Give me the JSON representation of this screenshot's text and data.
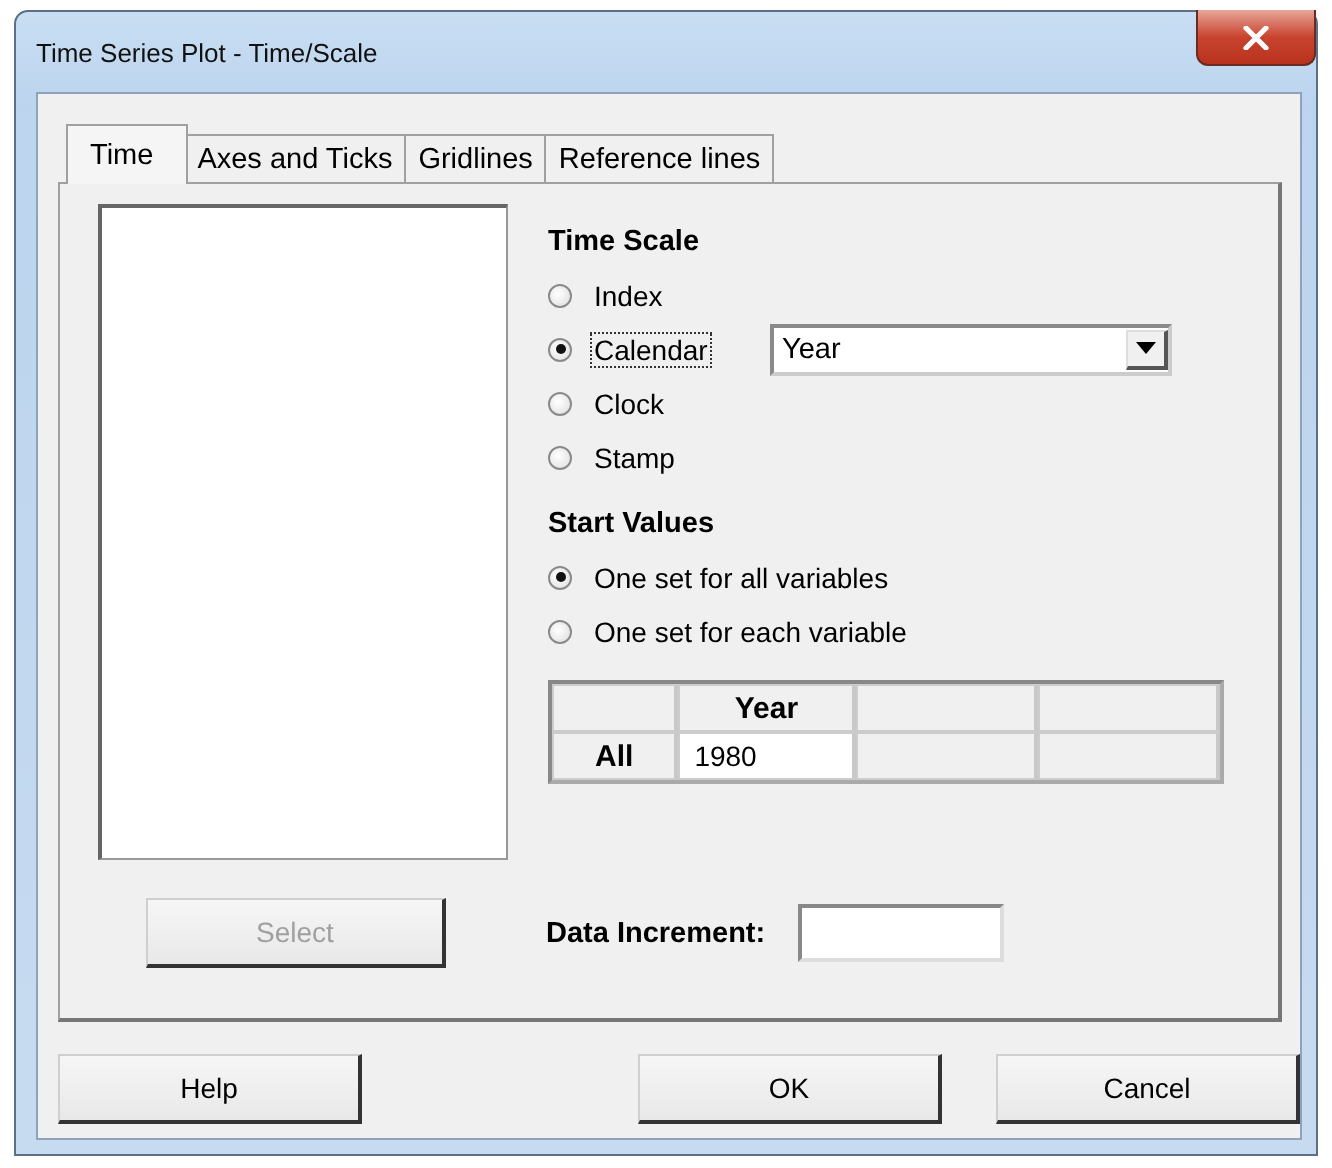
{
  "window": {
    "title": "Time Series Plot - Time/Scale"
  },
  "tabs": [
    {
      "label": "Time",
      "selected": true
    },
    {
      "label": "Axes and Ticks",
      "selected": false
    },
    {
      "label": "Gridlines",
      "selected": false
    },
    {
      "label": "Reference lines",
      "selected": false
    }
  ],
  "select_button": {
    "label": "Select",
    "disabled": true
  },
  "time_scale": {
    "heading": "Time Scale",
    "options": [
      {
        "label": "Index",
        "selected": false,
        "focused": false
      },
      {
        "label": "Calendar",
        "selected": true,
        "focused": true
      },
      {
        "label": "Clock",
        "selected": false,
        "focused": false
      },
      {
        "label": "Stamp",
        "selected": false,
        "focused": false
      }
    ],
    "calendar_dropdown": {
      "value": "Year"
    }
  },
  "start_values": {
    "heading": "Start Values",
    "options": [
      {
        "label": "One set for all variables",
        "selected": true
      },
      {
        "label": "One set for each variable",
        "selected": false
      }
    ],
    "table": {
      "columns": [
        "",
        "Year",
        "",
        ""
      ],
      "rows": [
        {
          "header": "All",
          "cells": [
            "1980",
            "",
            ""
          ]
        }
      ]
    }
  },
  "data_increment": {
    "label": "Data Increment:"
  },
  "buttons": [
    {
      "label": "Help"
    },
    {
      "label": "OK"
    },
    {
      "label": "Cancel"
    }
  ]
}
